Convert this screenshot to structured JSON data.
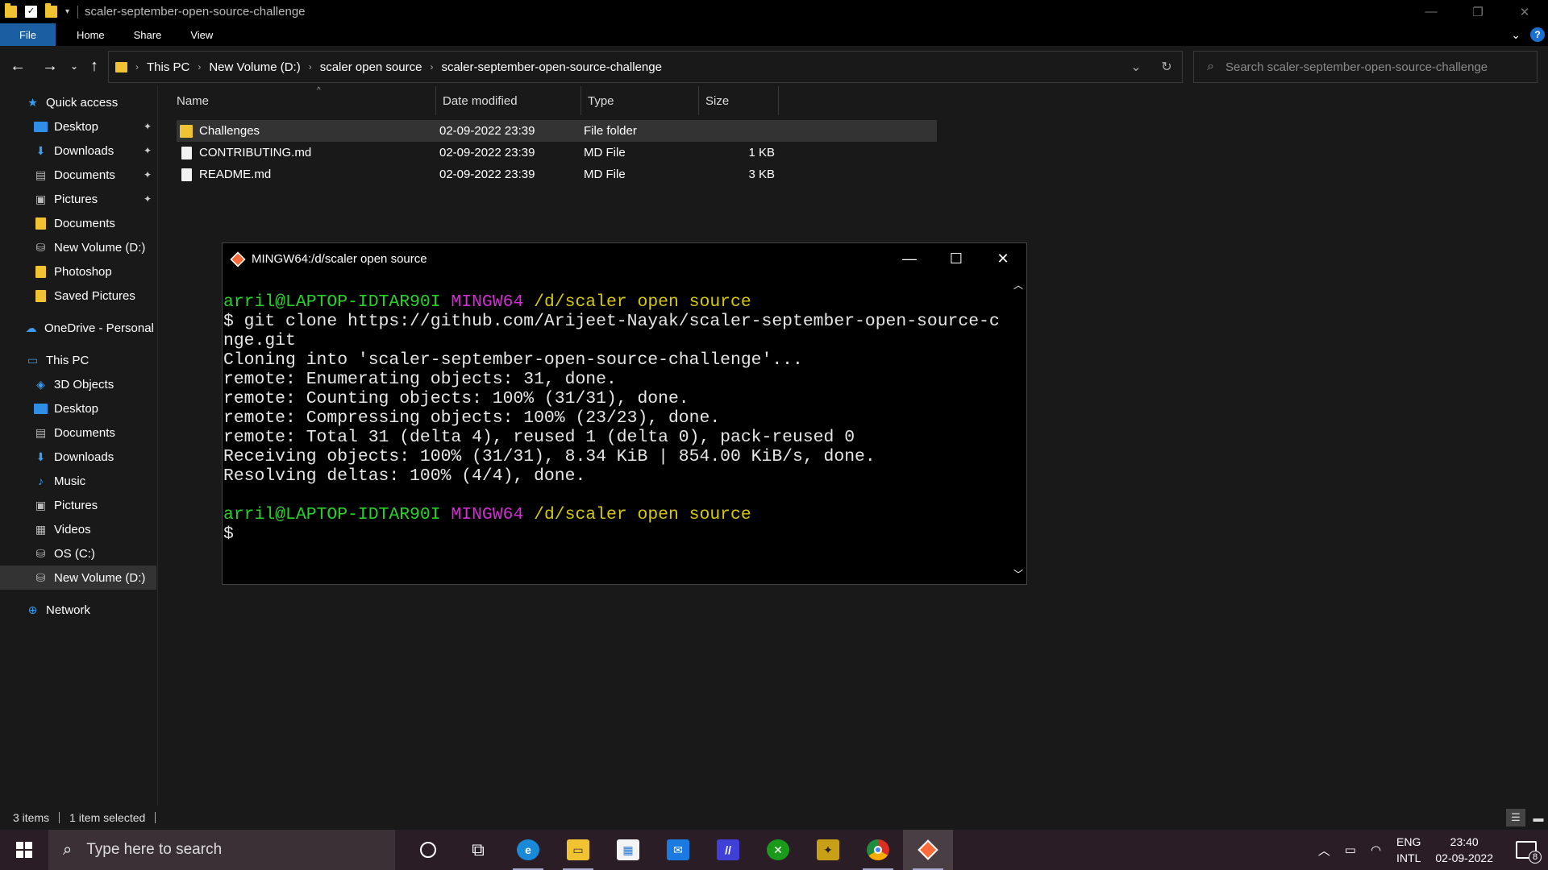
{
  "window": {
    "title": "scaler-september-open-source-challenge"
  },
  "ribbon": {
    "tabs": [
      "File",
      "Home",
      "Share",
      "View"
    ],
    "help": "?"
  },
  "address": {
    "crumbs": [
      "This PC",
      "New Volume (D:)",
      "scaler open source",
      "scaler-september-open-source-challenge"
    ]
  },
  "search": {
    "placeholder": "Search scaler-september-open-source-challenge"
  },
  "sidebar": {
    "items": [
      {
        "label": "Quick access",
        "icon": "star-icon"
      },
      {
        "label": "Desktop",
        "icon": "desktop-icon",
        "pinned": true
      },
      {
        "label": "Downloads",
        "icon": "download-icon",
        "pinned": true
      },
      {
        "label": "Documents",
        "icon": "document-icon",
        "pinned": true
      },
      {
        "label": "Pictures",
        "icon": "pictures-icon",
        "pinned": true
      },
      {
        "label": "Documents",
        "icon": "folder-icon"
      },
      {
        "label": "New Volume (D:)",
        "icon": "drive-icon"
      },
      {
        "label": "Photoshop",
        "icon": "folder-icon"
      },
      {
        "label": "Saved Pictures",
        "icon": "folder-icon"
      },
      {
        "label": "OneDrive - Personal",
        "icon": "cloud-icon"
      },
      {
        "label": "This PC",
        "icon": "computer-icon"
      },
      {
        "label": "3D Objects",
        "icon": "cube-icon"
      },
      {
        "label": "Desktop",
        "icon": "desktop-icon"
      },
      {
        "label": "Documents",
        "icon": "document-icon"
      },
      {
        "label": "Downloads",
        "icon": "download-icon"
      },
      {
        "label": "Music",
        "icon": "music-icon"
      },
      {
        "label": "Pictures",
        "icon": "pictures-icon"
      },
      {
        "label": "Videos",
        "icon": "video-icon"
      },
      {
        "label": "OS (C:)",
        "icon": "drive-icon"
      },
      {
        "label": "New Volume (D:)",
        "icon": "drive-icon",
        "selected": true
      },
      {
        "label": "Network",
        "icon": "network-icon"
      }
    ]
  },
  "table": {
    "headers": {
      "name": "Name",
      "date": "Date modified",
      "type": "Type",
      "size": "Size"
    },
    "rows": [
      {
        "name": "Challenges",
        "date": "02-09-2022 23:39",
        "type": "File folder",
        "size": "",
        "kind": "folder",
        "selected": true
      },
      {
        "name": "CONTRIBUTING.md",
        "date": "02-09-2022 23:39",
        "type": "MD File",
        "size": "1 KB",
        "kind": "file"
      },
      {
        "name": "README.md",
        "date": "02-09-2022 23:39",
        "type": "MD File",
        "size": "3 KB",
        "kind": "file"
      }
    ]
  },
  "terminal": {
    "title": "MINGW64:/d/scaler open source",
    "prompt_user": "arril@LAPTOP-IDTAR90I",
    "prompt_env": "MINGW64",
    "prompt_path": "/d/scaler open source",
    "lines": [
      "$ git clone https://github.com/Arijeet-Nayak/scaler-september-open-source-c",
      "nge.git",
      "Cloning into 'scaler-september-open-source-challenge'...",
      "remote: Enumerating objects: 31, done.",
      "remote: Counting objects: 100% (31/31), done.",
      "remote: Compressing objects: 100% (23/23), done.",
      "remote: Total 31 (delta 4), reused 1 (delta 0), pack-reused 0",
      "Receiving objects: 100% (31/31), 8.34 KiB | 854.00 KiB/s, done.",
      "Resolving deltas: 100% (4/4), done."
    ],
    "cursor_line": "$"
  },
  "status": {
    "items": "3 items",
    "selected": "1 item selected"
  },
  "taskbar": {
    "search_placeholder": "Type here to search",
    "lang_top": "ENG",
    "lang_bottom": "INTL",
    "time": "23:40",
    "date": "02-09-2022",
    "notifications": "8"
  }
}
